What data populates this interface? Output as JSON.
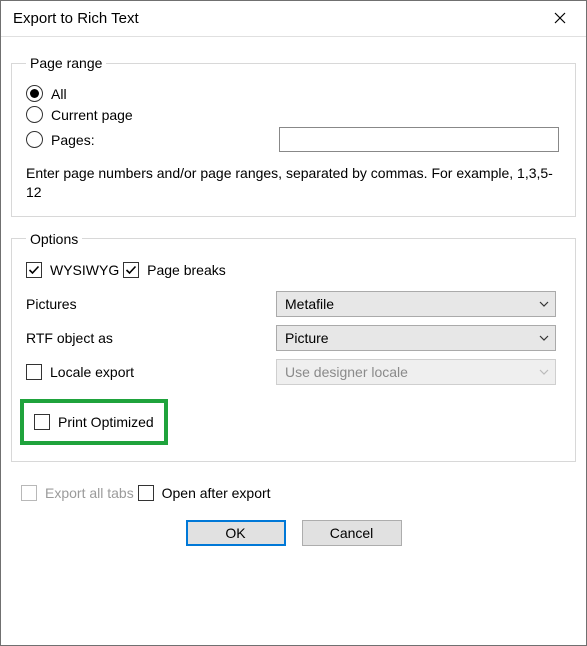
{
  "window": {
    "title": "Export to Rich Text"
  },
  "pageRange": {
    "legend": "Page range",
    "all": "All",
    "current": "Current page",
    "pages": "Pages:",
    "pages_value": "",
    "hint": "Enter page numbers and/or page ranges, separated by commas. For example, 1,3,5-12"
  },
  "options": {
    "legend": "Options",
    "wysiwyg": "WYSIWYG",
    "pageBreaks": "Page breaks",
    "pictures_label": "Pictures",
    "pictures_value": "Metafile",
    "rtf_label": "RTF object as",
    "rtf_value": "Picture",
    "locale_export": "Locale export",
    "locale_combo": "Use designer locale",
    "print_optimized": "Print Optimized"
  },
  "bottom": {
    "export_all_tabs": "Export all tabs",
    "open_after_export": "Open after export"
  },
  "buttons": {
    "ok": "OK",
    "cancel": "Cancel"
  }
}
